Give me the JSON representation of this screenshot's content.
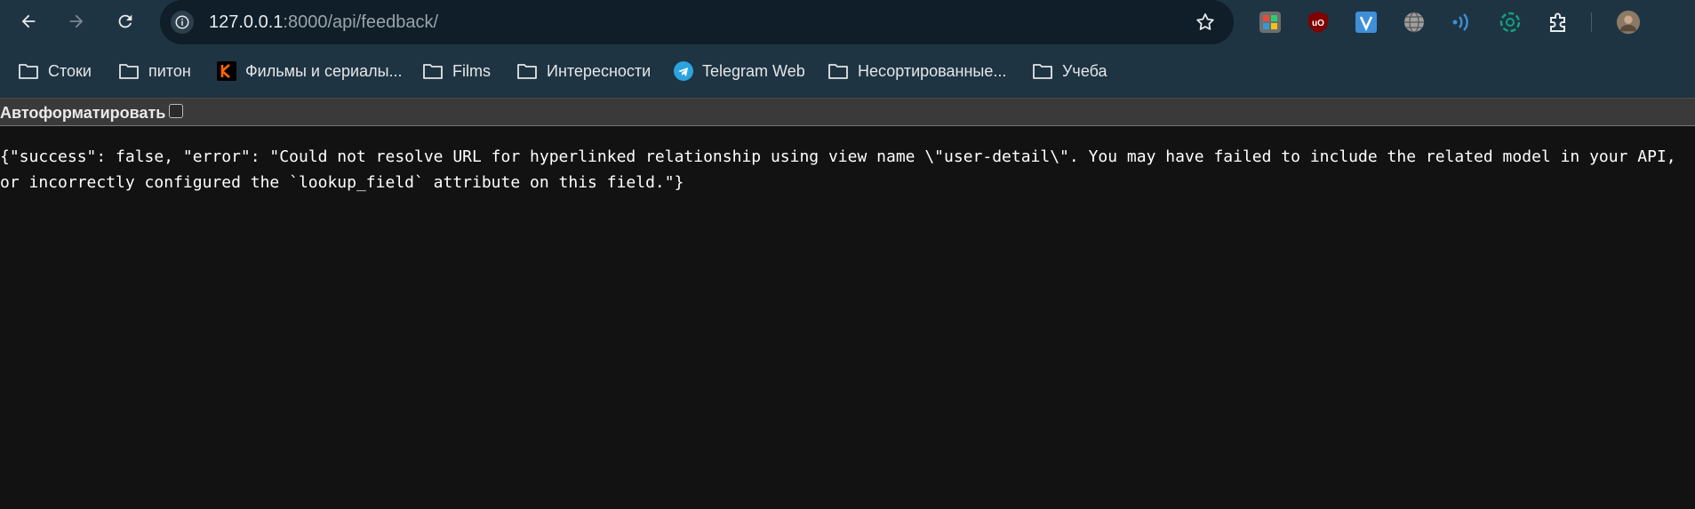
{
  "browser": {
    "url_host": "127.0.0.1",
    "url_rest": ":8000/api/feedback/"
  },
  "bookmarks": [
    {
      "label": "Стоки",
      "icon": "folder-icon"
    },
    {
      "label": "питон",
      "icon": "folder-icon"
    },
    {
      "label": "Фильмы и сериалы...",
      "icon": "kinopoisk-icon"
    },
    {
      "label": "Films",
      "icon": "folder-icon"
    },
    {
      "label": "Интересности",
      "icon": "folder-icon"
    },
    {
      "label": "Telegram Web",
      "icon": "telegram-icon"
    },
    {
      "label": "Несортированные...",
      "icon": "folder-icon"
    },
    {
      "label": "Учеба",
      "icon": "folder-icon"
    }
  ],
  "extensions": [
    "color-picker-icon",
    "ublock-icon",
    "v-extension-icon",
    "globe-icon",
    "audio-wave-icon",
    "chatgpt-icon",
    "extensions-puzzle-icon",
    "profile-avatar"
  ],
  "pretty_print": {
    "label": "Автоформатировать",
    "checked": false
  },
  "content": {
    "json_text": "{\"success\": false, \"error\": \"Could not resolve URL for hyperlinked relationship using view name \\\"user-detail\\\". You may have failed to include the related model in your API, or incorrectly configured the `lookup_field` attribute on this field.\"}"
  },
  "colors": {
    "toolbar_bg": "#1f3442",
    "omnibox_bg": "#0f1e28",
    "page_bg": "#121212",
    "pretty_bar_bg": "#3a3a3a"
  }
}
